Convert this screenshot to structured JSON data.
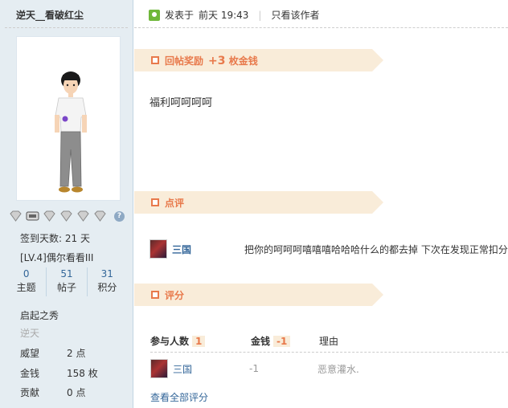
{
  "sidebar": {
    "author": "逆天__看破红尘",
    "sign_days": "签到天数: 21 天",
    "level": "[LV.4]偶尔看看III",
    "stats": [
      {
        "num": "0",
        "label": "主题"
      },
      {
        "num": "51",
        "label": "帖子"
      },
      {
        "num": "31",
        "label": "积分"
      }
    ],
    "group": "启起之秀",
    "rank": "逆天",
    "attrs": [
      {
        "k": "威望",
        "v": "2 点"
      },
      {
        "k": "金钱",
        "v": "158 枚"
      },
      {
        "k": "贡献",
        "v": "0 点"
      }
    ],
    "help_glyph": "?"
  },
  "post": {
    "posted_prefix": "发表于",
    "posted_time": "前天 19:43",
    "separator": "|",
    "only_author": "只看该作者",
    "reward_title": "回帖奖励",
    "reward_plus": "+3",
    "reward_unit": "枚金钱",
    "body": "福利呵呵呵呵",
    "review_title": "点评",
    "comment": {
      "user": "三国",
      "text": "把你的呵呵呵嘻嘻嘻哈哈哈什么的都去掉 下次在发现正常扣分"
    },
    "rating_title": "评分",
    "rating": {
      "participants_label": "参与人数",
      "participants": "1",
      "money_label": "金钱",
      "money_total": "-1",
      "reason_label": "理由",
      "row": {
        "user": "三国",
        "amount": "-1",
        "reason": "恶意灌水."
      },
      "view_all": "查看全部评分"
    }
  },
  "colors": {
    "accent": "#e8794b",
    "banner_bg": "#f9ecd9",
    "link": "#336699",
    "sidebar_bg": "#e5edf2"
  }
}
